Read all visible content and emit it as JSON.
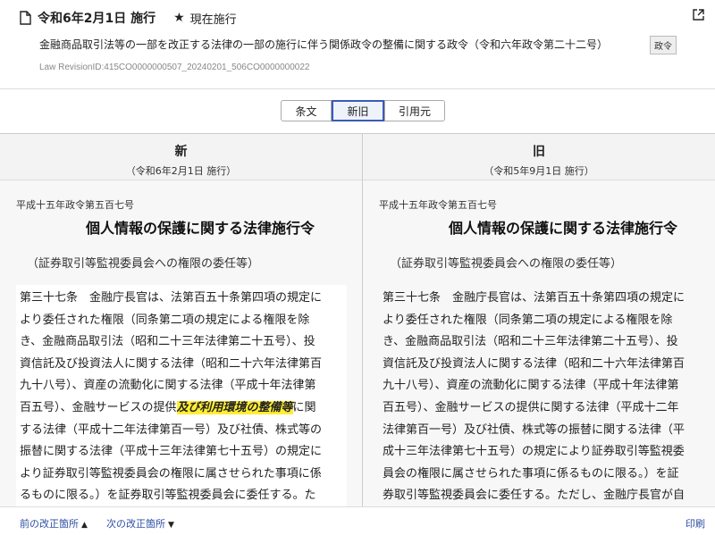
{
  "header": {
    "date_title": "令和6年2月1日 施行",
    "current_label": "現在施行",
    "law_title": "金融商品取引法等の一部を改正する法律の一部の施行に伴う関係政令の整備に関する政令（令和六年政令第二十二号）",
    "law_badge": "政令",
    "revision_id": "Law RevisionID:415CO0000000507_20240201_506CO0000000022"
  },
  "tabs": [
    {
      "label": "条文"
    },
    {
      "label": "新旧",
      "active": true
    },
    {
      "label": "引用元"
    }
  ],
  "columns": {
    "new": {
      "label": "新",
      "date": "（令和6年2月1日 施行）"
    },
    "old": {
      "label": "旧",
      "date": "（令和5年9月1日 施行）"
    }
  },
  "left": {
    "law_num": "平成十五年政令第五百七号",
    "law_name": "個人情報の保護に関する法律施行令",
    "caption": "（証券取引等監視委員会への権限の委任等）",
    "lines": [
      "第三十七条　金融庁長官は、法第百五十条第四項の規定に",
      "より委任された権限（同条第二項の規定による権限を除",
      "き、金融商品取引法（昭和二十三年法律第二十五号）、投",
      "資信託及び投資法人に関する法律（昭和二十六年法律第百",
      "九十八号）、資産の流動化に関する法律（平成十年法律第",
      "百五号）、金融サービスの提供",
      "する法律（平成十二年法律第百一号）及び社債、株式等の",
      "振替に関する法律（平成十三年法律第七十五号）の規定に",
      "より証券取引等監視委員会の権限に属させられた事項に係",
      "るものに限る。）を証券取引等監視委員会に委任する。た"
    ],
    "highlight": "及び利用環境の整備等",
    "after_highlight": "に関"
  },
  "right": {
    "law_num": "平成十五年政令第五百七号",
    "law_name": "個人情報の保護に関する法律施行令",
    "caption": "（証券取引等監視委員会への権限の委任等）",
    "lines": [
      "第三十七条　金融庁長官は、法第百五十条第四項の規定に",
      "より委任された権限（同条第二項の規定による権限を除",
      "き、金融商品取引法（昭和二十三年法律第二十五号）、投",
      "資信託及び投資法人に関する法律（昭和二十六年法律第百",
      "九十八号）、資産の流動化に関する法律（平成十年法律第",
      "百五号）、金融サービスの提供に関する法律（平成十二年",
      "法律第百一号）及び社債、株式等の振替に関する法律（平",
      "成十三年法律第七十五号）の規定により証券取引等監視委",
      "員会の権限に属させられた事項に係るものに限る。）を証",
      "券取引等監視委員会に委任する。ただし、金融庁長官が自"
    ]
  },
  "footer": {
    "prev_label": "前の改正箇所",
    "next_label": "次の改正箇所",
    "print_label": "印刷"
  }
}
